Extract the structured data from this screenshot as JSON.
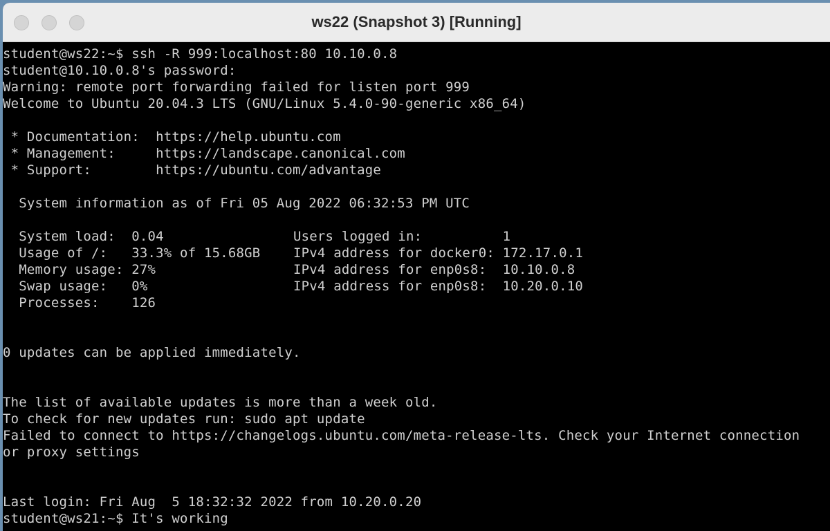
{
  "window": {
    "title": "ws22 (Snapshot 3) [Running]"
  },
  "terminal": {
    "lines": [
      "student@ws22:~$ ssh -R 999:localhost:80 10.10.0.8",
      "student@10.10.0.8's password:",
      "Warning: remote port forwarding failed for listen port 999",
      "Welcome to Ubuntu 20.04.3 LTS (GNU/Linux 5.4.0-90-generic x86_64)",
      "",
      " * Documentation:  https://help.ubuntu.com",
      " * Management:     https://landscape.canonical.com",
      " * Support:        https://ubuntu.com/advantage",
      "",
      "  System information as of Fri 05 Aug 2022 06:32:53 PM UTC",
      "",
      "  System load:  0.04",
      "  Usage of /:   33.3% of 15.68GB",
      "  Memory usage: 27%",
      "  Swap usage:   0%",
      "  Processes:    126",
      "",
      "",
      "0 updates can be applied immediately.",
      "",
      "",
      "The list of available updates is more than a week old.",
      "To check for new updates run: sudo apt update",
      "Failed to connect to https://changelogs.ubuntu.com/meta-release-lts. Check your Internet connection",
      "or proxy settings",
      "",
      "",
      "Last login: Fri Aug  5 18:32:32 2022 from 10.20.0.20",
      "student@ws21:~$ It's working"
    ],
    "sysinfo_right": [
      "Users logged in:          1",
      "IPv4 address for docker0: 172.17.0.1",
      "IPv4 address for enp0s8:  10.10.0.8",
      "IPv4 address for enp0s8:  10.20.0.10"
    ]
  }
}
